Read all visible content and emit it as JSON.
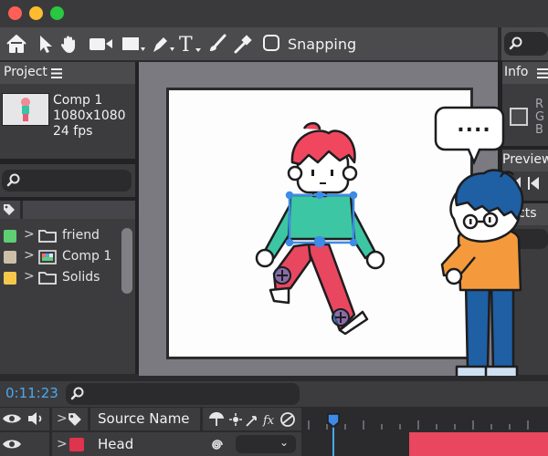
{
  "window": {
    "lights": [
      "#ff5f57",
      "#febc2e",
      "#28c840"
    ]
  },
  "toolbar": {
    "tools": [
      "home-icon",
      "pointer-icon",
      "hand-icon",
      "camera-icon",
      "rectangle-icon",
      "pen-icon",
      "text-icon",
      "brush-icon",
      "puppet-pin-icon"
    ],
    "snapping_label": "Snapping",
    "snapping_checked": false
  },
  "project": {
    "title": "Project",
    "comp": {
      "name": "Comp 1",
      "size": "1080x1080",
      "fps": "24 fps"
    },
    "items": [
      {
        "name": "friend",
        "color": "#5fcf74",
        "type": "folder"
      },
      {
        "name": "Comp 1",
        "color": "#cbbfa8",
        "type": "composition"
      },
      {
        "name": "Solids",
        "color": "#f5c84c",
        "type": "folder"
      }
    ]
  },
  "info": {
    "title": "Info",
    "channels": "R\nG\nB"
  },
  "preview": {
    "title": "Preview"
  },
  "effects": {
    "title": "Effects"
  },
  "bubble": {
    "text": "...."
  },
  "timeline": {
    "timecode": "0:11:23",
    "column_source": "Source Name",
    "layer": {
      "name": "Head",
      "color": "#e0334d"
    }
  },
  "colors": {
    "accent": "#3d8be6",
    "timecode": "#4aa8f0",
    "bar": "#e8475f"
  }
}
